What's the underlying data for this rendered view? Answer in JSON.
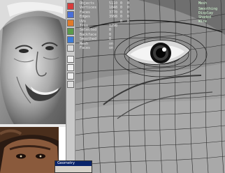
{
  "viewport": {
    "stats": [
      {
        "label": "Objects",
        "value": "5110",
        "a": "0",
        "b": "0"
      },
      {
        "label": "Vertices",
        "value": "1848",
        "a": "0",
        "b": "0"
      },
      {
        "label": "Faces",
        "value": "3770",
        "a": "0",
        "b": "0"
      },
      {
        "label": "Edges",
        "value": "3998",
        "a": "0",
        "b": "0"
      },
      {
        "label": "UVs",
        "value": "",
        "a": "0",
        "b": "0"
      },
      {
        "label": "Tris",
        "value": "1298",
        "a": "",
        "b": ""
      },
      {
        "label": "Selected",
        "value": "0",
        "a": "",
        "b": ""
      },
      {
        "label": "Backface",
        "value": "0",
        "a": "",
        "b": ""
      },
      {
        "label": "Smoothed",
        "value": "0",
        "a": "",
        "b": ""
      },
      {
        "label": "Mesh",
        "value": "on",
        "a": "",
        "b": ""
      },
      {
        "label": "Faces",
        "value": "on",
        "a": "",
        "b": ""
      }
    ],
    "dropdown_value": "Mesh",
    "status": [
      "Smoothing",
      "Display",
      "Shaded",
      "Wire"
    ]
  },
  "dialog": {
    "title": "Geometry"
  },
  "colors": {
    "mesh_fill": "#8c8c8c",
    "wire": "#2a2a2a",
    "stats_text": "#eaeaea",
    "dialog_title": "#0a246a"
  },
  "toolbar": {
    "tools": [
      "select-tool-icon",
      "move-tool-icon",
      "rotate-tool-icon",
      "scale-tool-icon",
      "paint-tool-icon",
      "lasso-tool-icon",
      "view-tool-icon",
      "render-tool-icon"
    ]
  }
}
